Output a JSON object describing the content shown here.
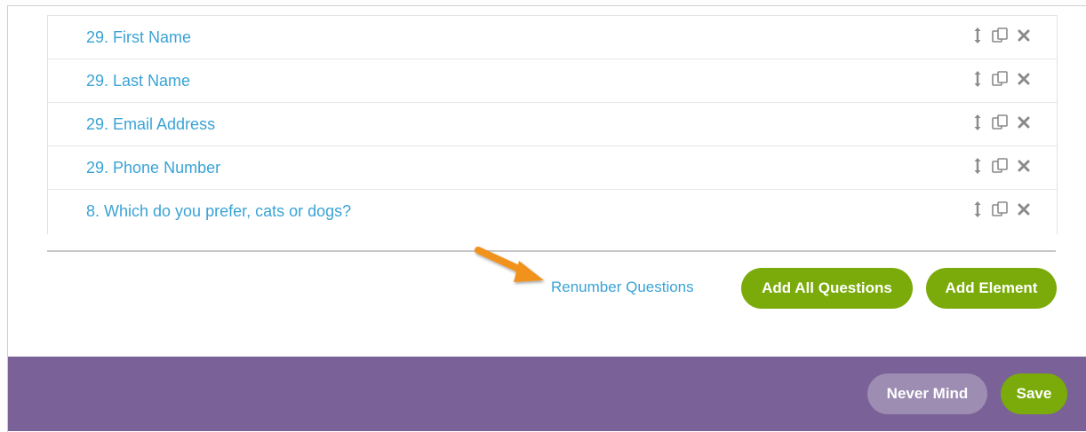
{
  "questions": [
    {
      "label": "29. First Name"
    },
    {
      "label": "29. Last Name"
    },
    {
      "label": "29. Email Address"
    },
    {
      "label": "29. Phone Number"
    },
    {
      "label": "8. Which do you prefer, cats or dogs?"
    }
  ],
  "row_icons": [
    "reorder-icon",
    "copy-icon",
    "delete-icon"
  ],
  "actions": {
    "renumber_label": "Renumber Questions",
    "add_all_label": "Add All Questions",
    "add_element_label": "Add Element"
  },
  "footer": {
    "never_mind_label": "Never Mind",
    "save_label": "Save"
  },
  "colors": {
    "link": "#3aa3d5",
    "green": "#7aab0a",
    "footer": "#7a6197",
    "arrow": "#f0921e"
  }
}
